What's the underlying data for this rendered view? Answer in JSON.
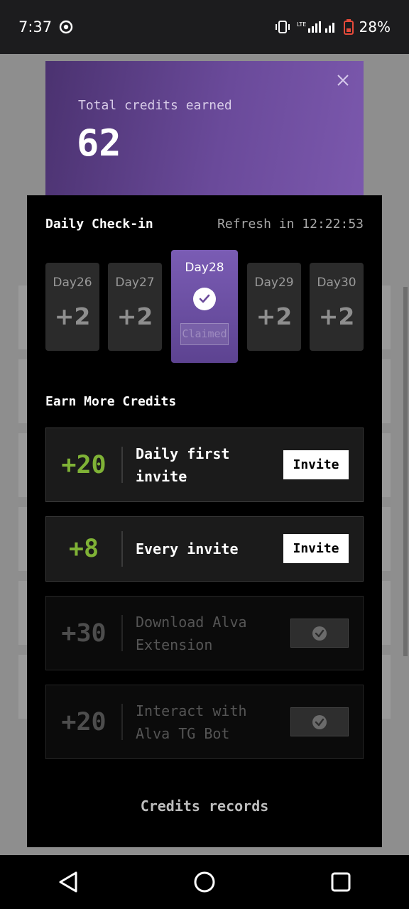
{
  "status_bar": {
    "time": "7:37",
    "battery": "28%"
  },
  "header": {
    "label": "Total credits earned",
    "value": "62"
  },
  "checkin": {
    "title": "Daily Check-in",
    "refresh": "Refresh in 12:22:53",
    "days": [
      {
        "label": "Day26",
        "value": "+2"
      },
      {
        "label": "Day27",
        "value": "+2"
      },
      {
        "label": "Day28",
        "status": "Claimed"
      },
      {
        "label": "Day29",
        "value": "+2"
      },
      {
        "label": "Day30",
        "value": "+2"
      }
    ]
  },
  "earn": {
    "title": "Earn More Credits",
    "tasks": [
      {
        "amount": "+20",
        "desc": "Daily first invite",
        "button": "Invite"
      },
      {
        "amount": "+8",
        "desc": "Every invite",
        "button": "Invite"
      },
      {
        "amount": "+30",
        "desc": "Download Alva Extension"
      },
      {
        "amount": "+20",
        "desc": "Interact with Alva TG Bot"
      }
    ]
  },
  "records_link": "Credits records",
  "colors": {
    "accent_purple": "#6a4a9a",
    "credit_green": "#7fb236"
  }
}
